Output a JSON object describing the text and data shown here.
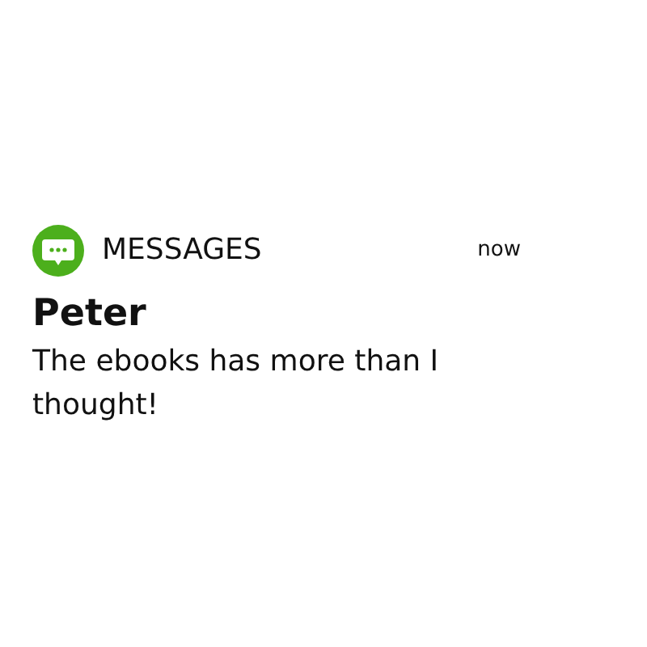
{
  "notification": {
    "app_name": "MESSAGES",
    "time": "now",
    "sender": "Peter",
    "message": "The ebooks has more than I thought!"
  }
}
